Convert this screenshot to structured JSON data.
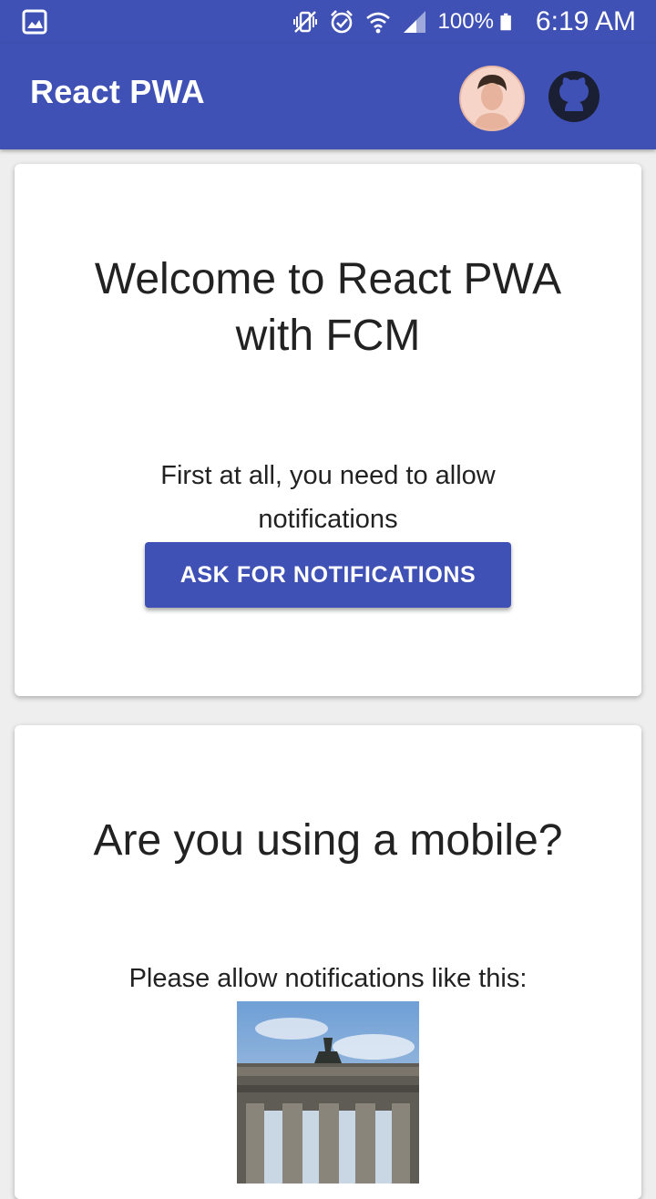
{
  "status_bar": {
    "battery": "100%",
    "time": "6:19 AM",
    "icons": [
      "image-icon",
      "vibrate-icon",
      "alarm-icon",
      "wifi-icon",
      "signal-icon",
      "battery-icon"
    ]
  },
  "app_bar": {
    "title": "React PWA",
    "icons": [
      "avatar",
      "github-icon"
    ],
    "color": "#3f51b5"
  },
  "card1": {
    "title_line1": "Welcome to React PWA",
    "title_line2": "with FCM",
    "text_line1": "First at all, you need to allow",
    "text_line2": "notifications",
    "button_label": "ASK FOR NOTIFICATIONS"
  },
  "card2": {
    "title": "Are you using a mobile?",
    "text": "Please allow notifications like this:",
    "image_icon": "brandenburg-gate-photo"
  }
}
